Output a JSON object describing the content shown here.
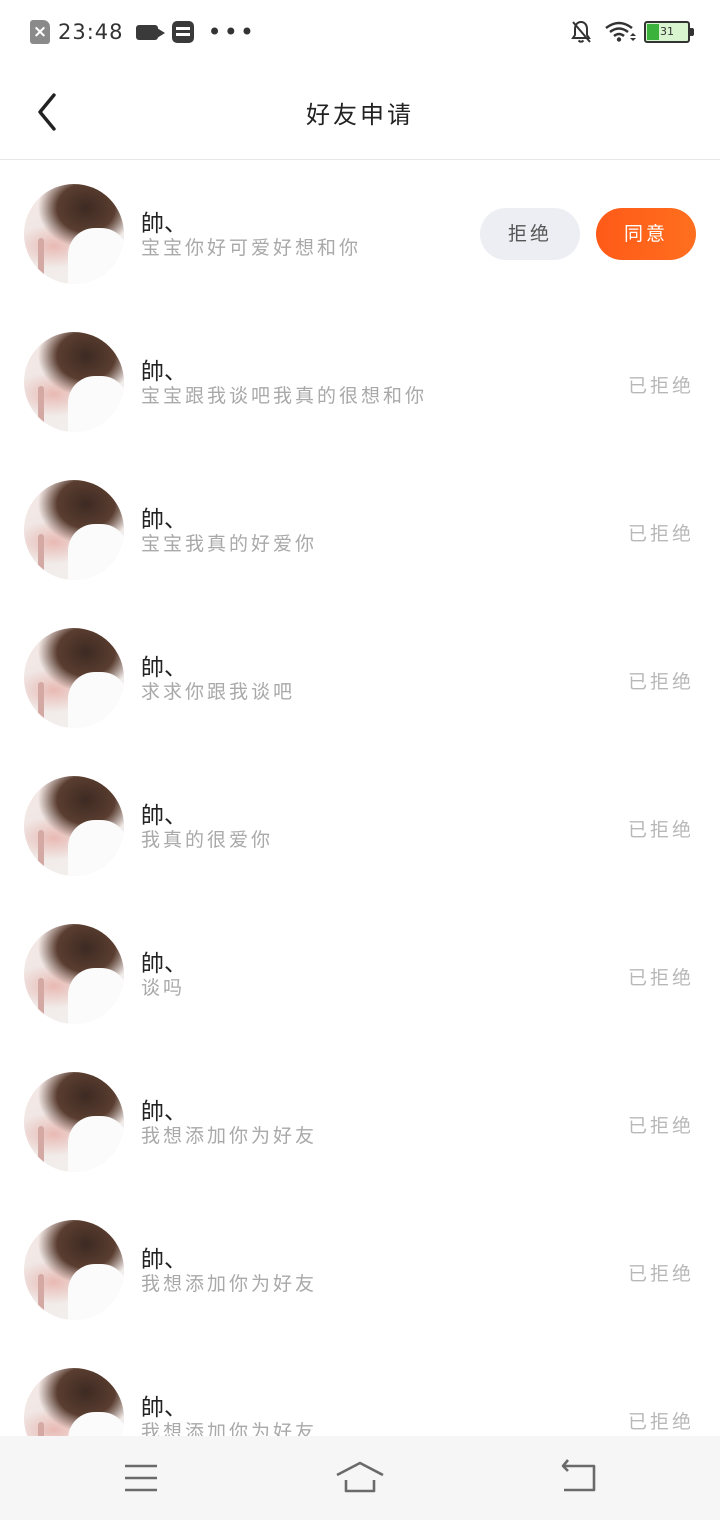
{
  "status_bar": {
    "time": "23:48",
    "more": "•••",
    "battery_level": "31",
    "battery_fraction": 0.31
  },
  "header": {
    "title": "好友申请"
  },
  "actions": {
    "reject_label": "拒绝",
    "agree_label": "同意"
  },
  "requests": [
    {
      "name": "帥、",
      "message": "宝宝你好可爱好想和你",
      "status": ""
    },
    {
      "name": "帥、",
      "message": "宝宝跟我谈吧我真的很想和你",
      "status": "已拒绝"
    },
    {
      "name": "帥、",
      "message": "宝宝我真的好爱你",
      "status": "已拒绝"
    },
    {
      "name": "帥、",
      "message": "求求你跟我谈吧",
      "status": "已拒绝"
    },
    {
      "name": "帥、",
      "message": "我真的很爱你",
      "status": "已拒绝"
    },
    {
      "name": "帥、",
      "message": "谈吗",
      "status": "已拒绝"
    },
    {
      "name": "帥、",
      "message": "我想添加你为好友",
      "status": "已拒绝"
    },
    {
      "name": "帥、",
      "message": "我想添加你为好友",
      "status": "已拒绝"
    },
    {
      "name": "帥、",
      "message": "我想添加你为好友",
      "status": "已拒绝"
    }
  ],
  "icons": {
    "sim": "sim-error-icon",
    "video": "video-icon",
    "app": "app-notification-icon",
    "bell": "bell-off-icon",
    "wifi": "wifi-icon",
    "battery": "battery-icon",
    "back": "chevron-left-icon",
    "menu": "menu-icon",
    "home": "home-icon",
    "return": "return-icon"
  },
  "colors": {
    "accent": "#ff5a18",
    "reject_bg": "#eceef3",
    "status_text": "#b8b8b8",
    "message_text": "#a9a9a9"
  }
}
